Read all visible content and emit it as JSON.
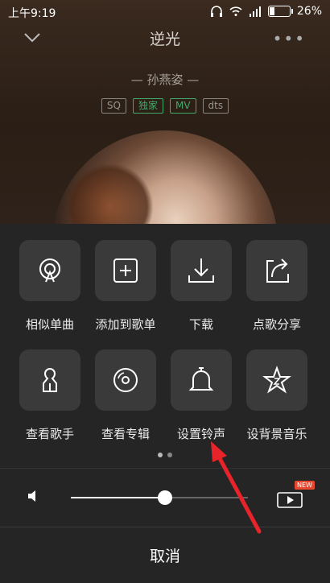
{
  "status_bar": {
    "time": "上午9:19",
    "battery": "26%",
    "battery_level": 0.26
  },
  "player": {
    "song_title": "逆光",
    "artist": "— 孙燕姿 —",
    "more_label": "•••",
    "badges": [
      {
        "label": "SQ",
        "color": "#9a9590"
      },
      {
        "label": "独家",
        "color": "#3faa6b"
      },
      {
        "label": "MV",
        "color": "#3faa6b"
      },
      {
        "label": "dts",
        "color": "#9a9590"
      }
    ]
  },
  "menu": {
    "items": [
      {
        "label": "相似单曲",
        "icon": "similar-songs-icon"
      },
      {
        "label": "添加到歌单",
        "icon": "add-to-playlist-icon"
      },
      {
        "label": "下载",
        "icon": "download-icon"
      },
      {
        "label": "点歌分享",
        "icon": "share-icon"
      },
      {
        "label": "查看歌手",
        "icon": "singer-icon"
      },
      {
        "label": "查看专辑",
        "icon": "album-icon"
      },
      {
        "label": "设置铃声",
        "icon": "bell-icon"
      },
      {
        "label": "设背景音乐",
        "icon": "star-icon"
      }
    ],
    "page_count": 2,
    "active_page": 0
  },
  "volume": {
    "level": 0.53
  },
  "mv_button": {
    "new_badge": "NEW"
  },
  "cancel_label": "取消",
  "annotation": {
    "arrow_color": "#e8232a"
  }
}
